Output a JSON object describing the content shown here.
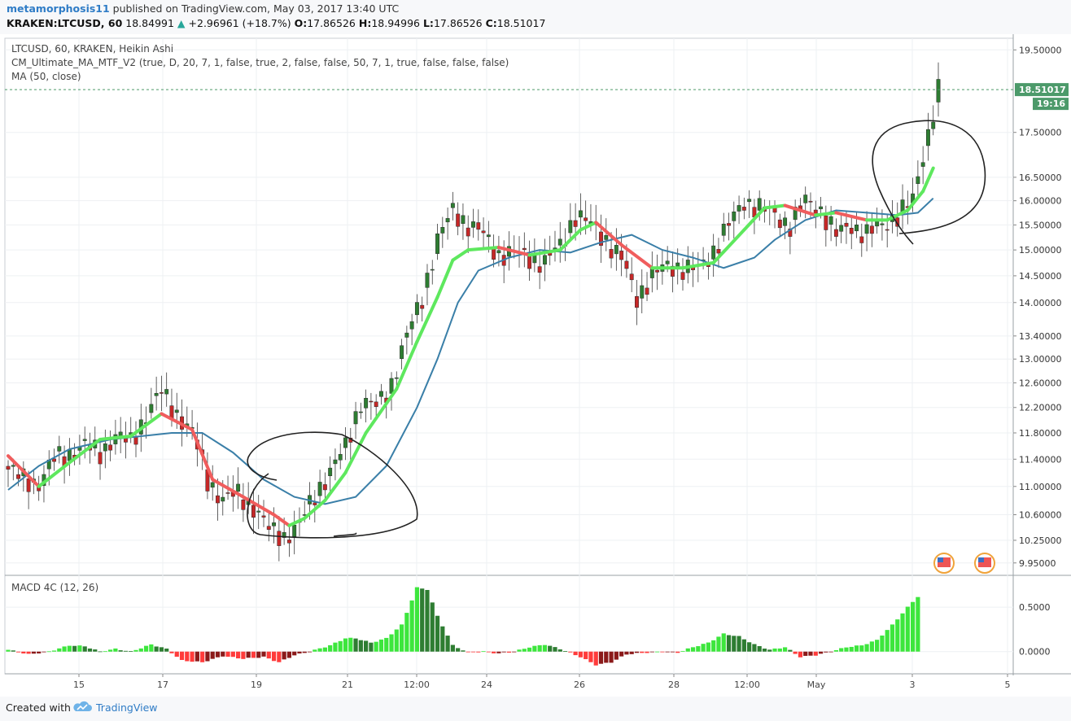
{
  "header": {
    "author": "metamorphosis11",
    "published": "published on TradingView.com, May 03, 2017 13:40 UTC",
    "symbol_line": "KRAKEN:LTCUSD, 60",
    "open_price": "18.84991",
    "change": "+2.96961 (+18.7%)",
    "o_label": "O:",
    "o_value": "17.86526",
    "h_label": "H:",
    "h_value": "18.94996",
    "l_label": "L:",
    "l_value": "17.86526",
    "c_label": "C:",
    "c_value": "18.51017"
  },
  "legend": {
    "line1": "LTCUSD, 60, KRAKEN, Heikin Ashi",
    "line2": "CM_Ultimate_MA_MTF_V2 (true, D, 20, 7, 1, false, true, 2, false, false, 50, 7, 1, true, false, false, false)",
    "line3": "MA (50, close)"
  },
  "macd_label": "MACD 4C (12, 26)",
  "footer": {
    "created_with": "Created with",
    "brand": "TradingView"
  },
  "colors": {
    "bull": "#26a69a",
    "bear": "#ef5350",
    "candle_up": "#2e7d32",
    "candle_down": "#c62828",
    "ma_green": "#5ee85e",
    "ma_red": "#f05d5d",
    "ma_blue": "#3a7fa8",
    "macd_up_strong": "#3de63d",
    "macd_up_weak": "#2e7d32",
    "macd_down_strong": "#ff3b3b",
    "macd_down_weak": "#8b1a1a",
    "price_line": "#4c9a6a"
  },
  "chart_data": [
    {
      "type": "candlestick",
      "title": "LTCUSD, 60, KRAKEN, Heikin Ashi",
      "x_ticks": [
        "15",
        "17",
        "19",
        "21",
        "12:00",
        "24",
        "26",
        "28",
        "12:00",
        "May",
        "3",
        "5"
      ],
      "y_ticks": [
        19.5,
        17.5,
        16.5,
        16.0,
        15.5,
        15.0,
        14.5,
        14.0,
        13.4,
        13.0,
        12.6,
        12.2,
        11.8,
        11.4,
        11.0,
        10.6,
        10.25,
        9.95
      ],
      "ylim": [
        9.8,
        19.8
      ],
      "last_price": "18.51017",
      "countdown": "19:16",
      "close_path": [
        [
          0,
          11.25
        ],
        [
          3,
          11.1
        ],
        [
          6,
          11.05
        ],
        [
          9,
          11.4
        ],
        [
          12,
          11.5
        ],
        [
          15,
          11.6
        ],
        [
          18,
          11.5
        ],
        [
          21,
          11.75
        ],
        [
          24,
          11.65
        ],
        [
          27,
          12.1
        ],
        [
          30,
          12.45
        ],
        [
          33,
          12.1
        ],
        [
          36,
          11.8
        ],
        [
          39,
          11.1
        ],
        [
          42,
          10.8
        ],
        [
          45,
          10.9
        ],
        [
          48,
          10.7
        ],
        [
          51,
          10.4
        ],
        [
          54,
          10.3
        ],
        [
          57,
          10.45
        ],
        [
          60,
          10.9
        ],
        [
          63,
          11.2
        ],
        [
          66,
          11.6
        ],
        [
          69,
          12.3
        ],
        [
          72,
          12.2
        ],
        [
          75,
          12.6
        ],
        [
          78,
          13.4
        ],
        [
          81,
          14.1
        ],
        [
          84,
          15.2
        ],
        [
          87,
          15.8
        ],
        [
          90,
          15.5
        ],
        [
          93,
          15.3
        ],
        [
          96,
          14.9
        ],
        [
          99,
          14.95
        ],
        [
          102,
          14.85
        ],
        [
          105,
          14.75
        ],
        [
          108,
          15.1
        ],
        [
          111,
          15.7
        ],
        [
          114,
          15.5
        ],
        [
          117,
          15.2
        ],
        [
          120,
          14.8
        ],
        [
          123,
          14.1
        ],
        [
          126,
          14.5
        ],
        [
          129,
          14.7
        ],
        [
          132,
          14.65
        ],
        [
          135,
          14.6
        ],
        [
          138,
          15.0
        ],
        [
          141,
          15.5
        ],
        [
          144,
          16.0
        ],
        [
          147,
          15.85
        ],
        [
          150,
          15.7
        ],
        [
          153,
          15.5
        ],
        [
          156,
          16.0
        ],
        [
          159,
          15.8
        ],
        [
          162,
          15.3
        ],
        [
          165,
          15.5
        ],
        [
          168,
          15.3
        ],
        [
          171,
          15.5
        ],
        [
          174,
          15.7
        ],
        [
          177,
          16.0
        ],
        [
          179,
          17.0
        ],
        [
          181,
          18.0
        ],
        [
          182,
          18.5
        ]
      ],
      "series": [
        {
          "name": "CM_Ultimate_MA_MTF_V2",
          "points": [
            [
              0,
              11.45
            ],
            [
              6,
              11.0
            ],
            [
              12,
              11.35
            ],
            [
              18,
              11.7
            ],
            [
              24,
              11.75
            ],
            [
              30,
              12.1
            ],
            [
              36,
              11.85
            ],
            [
              40,
              11.1
            ],
            [
              46,
              10.85
            ],
            [
              52,
              10.6
            ],
            [
              55,
              10.45
            ],
            [
              58,
              10.55
            ],
            [
              62,
              10.8
            ],
            [
              66,
              11.2
            ],
            [
              70,
              11.8
            ],
            [
              76,
              12.5
            ],
            [
              80,
              13.3
            ],
            [
              84,
              14.1
            ],
            [
              87,
              14.8
            ],
            [
              90,
              15.0
            ],
            [
              96,
              15.05
            ],
            [
              102,
              14.9
            ],
            [
              108,
              15.0
            ],
            [
              112,
              15.4
            ],
            [
              115,
              15.55
            ],
            [
              120,
              15.1
            ],
            [
              126,
              14.65
            ],
            [
              132,
              14.65
            ],
            [
              138,
              14.75
            ],
            [
              144,
              15.4
            ],
            [
              148,
              15.85
            ],
            [
              152,
              15.9
            ],
            [
              158,
              15.7
            ],
            [
              162,
              15.75
            ],
            [
              168,
              15.6
            ],
            [
              172,
              15.6
            ],
            [
              176,
              15.8
            ],
            [
              179,
              16.2
            ],
            [
              181,
              16.7
            ]
          ]
        },
        {
          "name": "MA (50, close)",
          "points": [
            [
              0,
              10.95
            ],
            [
              6,
              11.3
            ],
            [
              12,
              11.55
            ],
            [
              20,
              11.7
            ],
            [
              26,
              11.75
            ],
            [
              32,
              11.8
            ],
            [
              38,
              11.8
            ],
            [
              44,
              11.5
            ],
            [
              50,
              11.1
            ],
            [
              56,
              10.85
            ],
            [
              62,
              10.75
            ],
            [
              68,
              10.85
            ],
            [
              74,
              11.3
            ],
            [
              80,
              12.2
            ],
            [
              84,
              13.0
            ],
            [
              88,
              14.0
            ],
            [
              92,
              14.6
            ],
            [
              98,
              14.85
            ],
            [
              104,
              15.0
            ],
            [
              110,
              14.95
            ],
            [
              116,
              15.15
            ],
            [
              122,
              15.3
            ],
            [
              128,
              15.0
            ],
            [
              134,
              14.85
            ],
            [
              140,
              14.65
            ],
            [
              146,
              14.85
            ],
            [
              150,
              15.2
            ],
            [
              156,
              15.6
            ],
            [
              162,
              15.8
            ],
            [
              168,
              15.75
            ],
            [
              174,
              15.7
            ],
            [
              178,
              15.75
            ],
            [
              181,
              16.05
            ]
          ]
        }
      ]
    },
    {
      "type": "bar",
      "title": "MACD 4C (12, 26)",
      "y_ticks": [
        0.5,
        0.0
      ],
      "ylim": [
        -0.25,
        0.85
      ],
      "profile": [
        [
          0,
          0.02
        ],
        [
          4,
          -0.03
        ],
        [
          8,
          0.0
        ],
        [
          12,
          0.07
        ],
        [
          15,
          0.06
        ],
        [
          18,
          0.0
        ],
        [
          21,
          0.03
        ],
        [
          24,
          0.0
        ],
        [
          28,
          0.08
        ],
        [
          31,
          0.03
        ],
        [
          34,
          -0.1
        ],
        [
          38,
          -0.12
        ],
        [
          42,
          -0.05
        ],
        [
          46,
          -0.08
        ],
        [
          50,
          -0.06
        ],
        [
          53,
          -0.12
        ],
        [
          56,
          -0.04
        ],
        [
          59,
          0.0
        ],
        [
          63,
          0.07
        ],
        [
          66,
          0.15
        ],
        [
          68,
          0.15
        ],
        [
          71,
          0.1
        ],
        [
          74,
          0.15
        ],
        [
          77,
          0.3
        ],
        [
          80,
          0.72
        ],
        [
          82,
          0.7
        ],
        [
          84,
          0.4
        ],
        [
          87,
          0.07
        ],
        [
          90,
          -0.01
        ],
        [
          93,
          0.0
        ],
        [
          96,
          -0.02
        ],
        [
          99,
          0.0
        ],
        [
          102,
          0.05
        ],
        [
          105,
          0.08
        ],
        [
          108,
          0.03
        ],
        [
          112,
          -0.06
        ],
        [
          115,
          -0.15
        ],
        [
          118,
          -0.12
        ],
        [
          121,
          -0.03
        ],
        [
          125,
          -0.01
        ],
        [
          128,
          0.0
        ],
        [
          131,
          -0.01
        ],
        [
          134,
          0.05
        ],
        [
          137,
          0.1
        ],
        [
          140,
          0.2
        ],
        [
          143,
          0.17
        ],
        [
          146,
          0.08
        ],
        [
          149,
          0.02
        ],
        [
          152,
          0.05
        ],
        [
          155,
          -0.06
        ],
        [
          158,
          -0.04
        ],
        [
          161,
          0.0
        ],
        [
          164,
          0.05
        ],
        [
          167,
          0.07
        ],
        [
          170,
          0.13
        ],
        [
          173,
          0.3
        ],
        [
          176,
          0.5
        ],
        [
          178,
          0.62
        ]
      ]
    }
  ]
}
